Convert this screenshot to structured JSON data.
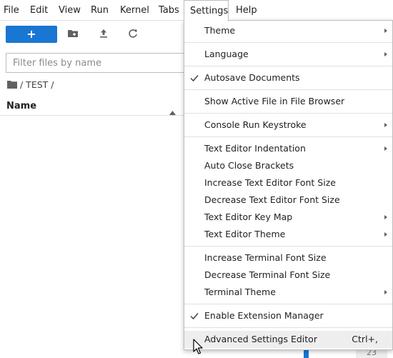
{
  "menubar": {
    "items": [
      {
        "label": "File"
      },
      {
        "label": "Edit"
      },
      {
        "label": "View"
      },
      {
        "label": "Run"
      },
      {
        "label": "Kernel"
      },
      {
        "label": "Tabs"
      },
      {
        "label": "Settings"
      },
      {
        "label": "Help"
      }
    ],
    "active": "Settings"
  },
  "file_browser": {
    "new_button": "+",
    "filter_placeholder": "Filter files by name",
    "breadcrumb": "/ TEST /",
    "column_name": "Name"
  },
  "background": {
    "partial_number": "23"
  },
  "settings_menu": {
    "items": [
      {
        "label": "Theme",
        "submenu": true
      },
      {
        "label": "Language",
        "submenu": true
      },
      {
        "label": "Autosave Documents",
        "checked": true
      },
      {
        "label": "Show Active File in File Browser"
      },
      {
        "label": "Console Run Keystroke",
        "submenu": true
      },
      {
        "label": "Text Editor Indentation",
        "submenu": true
      },
      {
        "label": "Auto Close Brackets"
      },
      {
        "label": "Increase Text Editor Font Size"
      },
      {
        "label": "Decrease Text Editor Font Size"
      },
      {
        "label": "Text Editor Key Map",
        "submenu": true
      },
      {
        "label": "Text Editor Theme",
        "submenu": true
      },
      {
        "label": "Increase Terminal Font Size"
      },
      {
        "label": "Decrease Terminal Font Size"
      },
      {
        "label": "Terminal Theme",
        "submenu": true
      },
      {
        "label": "Enable Extension Manager",
        "checked": true
      },
      {
        "label": "Advanced Settings Editor",
        "shortcut": "Ctrl+,",
        "hovered": true
      }
    ]
  },
  "colors": {
    "accent": "#1976d2",
    "menu_border": "#bdbdbd",
    "hover": "#eeeeee"
  }
}
